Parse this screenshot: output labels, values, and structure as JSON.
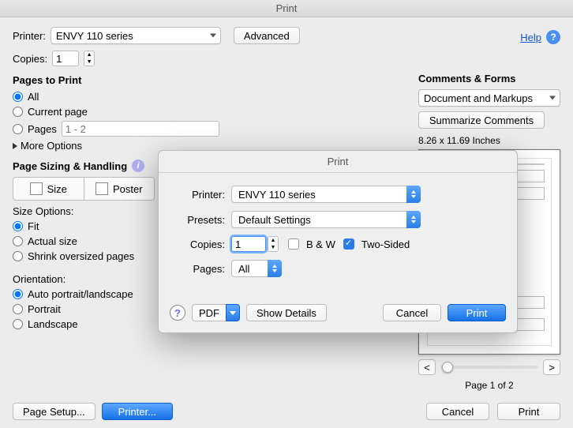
{
  "window": {
    "title": "Print"
  },
  "help": {
    "label": "Help"
  },
  "main": {
    "printer_label": "Printer:",
    "printer_value": "ENVY 110 series",
    "advanced": "Advanced",
    "copies_label": "Copies:",
    "copies_value": "1",
    "pages_to_print": "Pages to Print",
    "radio_all": "All",
    "radio_current": "Current page",
    "radio_pages": "Pages",
    "pages_placeholder": "1 - 2",
    "more_options": "More Options",
    "sizing_handling": "Page Sizing & Handling",
    "seg_size": "Size",
    "seg_poster": "Poster",
    "size_options_title": "Size Options:",
    "radio_fit": "Fit",
    "radio_actual": "Actual size",
    "radio_shrink": "Shrink oversized pages",
    "orientation_title": "Orientation:",
    "radio_auto": "Auto portrait/landscape",
    "radio_portrait": "Portrait",
    "radio_landscape": "Landscape"
  },
  "right": {
    "comments_title": "Comments & Forms",
    "comments_value": "Document and Markups",
    "summarize": "Summarize Comments",
    "dims": "8.26 x 11.69 Inches",
    "nav_prev": "<",
    "nav_next": ">",
    "page_of": "Page 1 of 2"
  },
  "footer": {
    "page_setup": "Page Setup...",
    "printer_btn": "Printer...",
    "cancel": "Cancel",
    "print": "Print"
  },
  "dialog": {
    "title": "Print",
    "printer_label": "Printer:",
    "printer_value": "ENVY 110 series",
    "presets_label": "Presets:",
    "presets_value": "Default Settings",
    "copies_label": "Copies:",
    "copies_value": "1",
    "bw_label": "B & W",
    "twosided_label": "Two-Sided",
    "pages_label": "Pages:",
    "pages_value": "All",
    "pdf": "PDF",
    "show_details": "Show Details",
    "cancel": "Cancel",
    "print": "Print"
  }
}
